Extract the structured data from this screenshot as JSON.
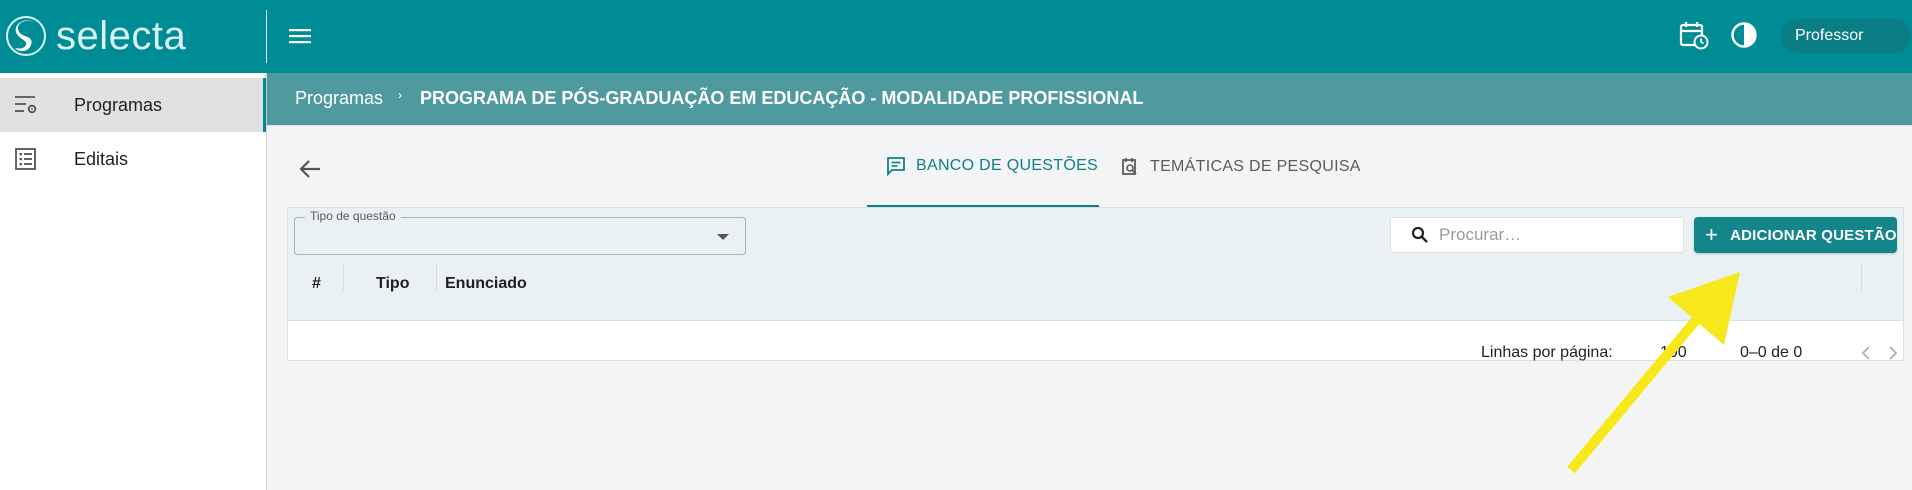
{
  "app": {
    "name": "selecta"
  },
  "colors": {
    "brand": "#008c95",
    "accent": "#15858c",
    "breadcrumb_bg": "#4f9a9e",
    "annotation_arrow": "#f7e81b"
  },
  "header": {
    "icons": [
      "menu-icon",
      "calendar-clock-icon",
      "contrast-icon"
    ],
    "user_label": "Professor"
  },
  "sidebar": {
    "items": [
      {
        "label": "Programas",
        "icon": "filter-settings-icon",
        "active": true
      },
      {
        "label": "Editais",
        "icon": "list-document-icon",
        "active": false
      }
    ]
  },
  "breadcrumb": {
    "root": "Programas",
    "separator": "›",
    "current": "PROGRAMA DE PÓS-GRADUAÇÃO EM EDUCAÇÃO - MODALIDADE PROFISSIONAL"
  },
  "tabs": [
    {
      "label": "BANCO DE QUESTÕES",
      "icon": "question-bank-icon",
      "active": true
    },
    {
      "label": "TEMÁTICAS DE PESQUISA",
      "icon": "search-document-icon",
      "active": false
    }
  ],
  "filters": {
    "question_type_label": "Tipo de questão",
    "question_type_value": ""
  },
  "search": {
    "placeholder": "Procurar…",
    "value": ""
  },
  "actions": {
    "add_label": "ADICIONAR QUESTÃO"
  },
  "table": {
    "columns": [
      "#",
      "Tipo",
      "Enunciado"
    ],
    "rows": []
  },
  "pagination": {
    "rows_per_page_label": "Linhas por página:",
    "rows_per_page": "100",
    "range": "0–0 de 0"
  }
}
